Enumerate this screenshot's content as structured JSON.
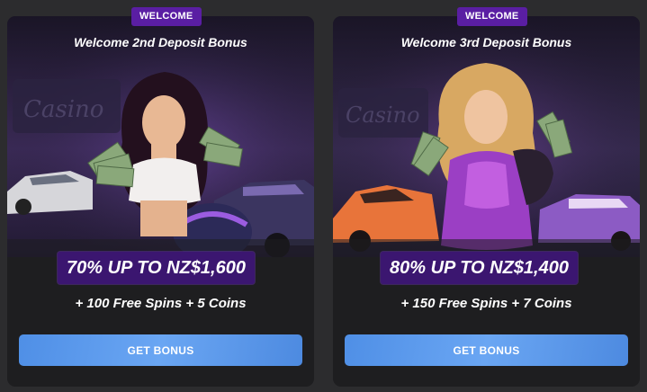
{
  "cards": [
    {
      "tag": "WELCOME",
      "title": "Welcome 2nd Deposit Bonus",
      "amount": "70% UP TO NZ$1,600",
      "extra": "+ 100 Free Spins + 5 Coins",
      "button": "GET BONUS"
    },
    {
      "tag": "WELCOME",
      "title": "Welcome 3rd Deposit Bonus",
      "amount": "80% UP TO NZ$1,400",
      "extra": "+ 150 Free Spins + 7 Coins",
      "button": "GET BONUS"
    }
  ],
  "colors": {
    "page_bg": "#2c2c2e",
    "card_bg": "#1e1e20",
    "tag_bg": "#5a1ea3",
    "amount_bg": "#3b1670",
    "button_bg": "#5a98ec"
  }
}
